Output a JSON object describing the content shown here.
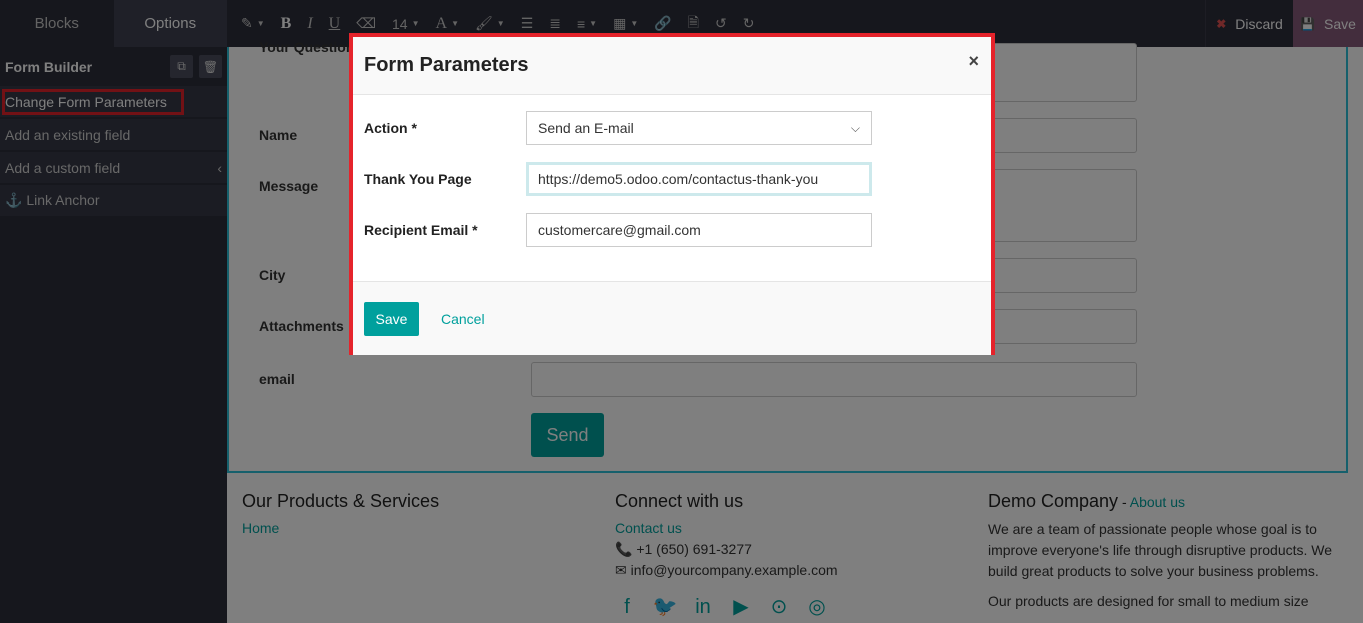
{
  "sidebar": {
    "tabs": [
      "Blocks",
      "Options"
    ],
    "header": "Form Builder",
    "items": [
      {
        "label": "Change Form Parameters"
      },
      {
        "label": "Add an existing field"
      },
      {
        "label": "Add a custom field"
      },
      {
        "label": "Link Anchor"
      }
    ]
  },
  "toolbar": {
    "font_size": "14",
    "bold": "B",
    "italic": "I",
    "underline": "U",
    "discard_label": "Discard",
    "save_label": "Save"
  },
  "form": {
    "partial_label": "Your Question",
    "labels": [
      "Name",
      "Message",
      "City",
      "Attachments",
      "email"
    ],
    "send_label": "Send"
  },
  "footer": {
    "col1": {
      "title": "Our Products & Services",
      "link": "Home"
    },
    "col2": {
      "title": "Connect with us",
      "link": "Contact us",
      "phone": "+1 (650) 691-3277",
      "email": "info@yourcompany.example.com"
    },
    "col3": {
      "title": "Demo Company",
      "dash": " - ",
      "link": "About us",
      "text1": "We are a team of passionate people whose goal is to improve everyone's life through disruptive products. We build great products to solve your business problems.",
      "text2": "Our products are designed for small to medium size"
    }
  },
  "modal": {
    "title": "Form Parameters",
    "fields": [
      {
        "label": "Action *",
        "value": "Send an E-mail"
      },
      {
        "label": "Thank You Page",
        "value": "https://demo5.odoo.com/contactus-thank-you"
      },
      {
        "label": "Recipient Email *",
        "value": "customercare@gmail.com"
      }
    ],
    "save_label": "Save",
    "cancel_label": "Cancel"
  },
  "colors": {
    "accent": "#00a09d",
    "highlight": "#e5232b",
    "save_purple": "#875a7b"
  }
}
